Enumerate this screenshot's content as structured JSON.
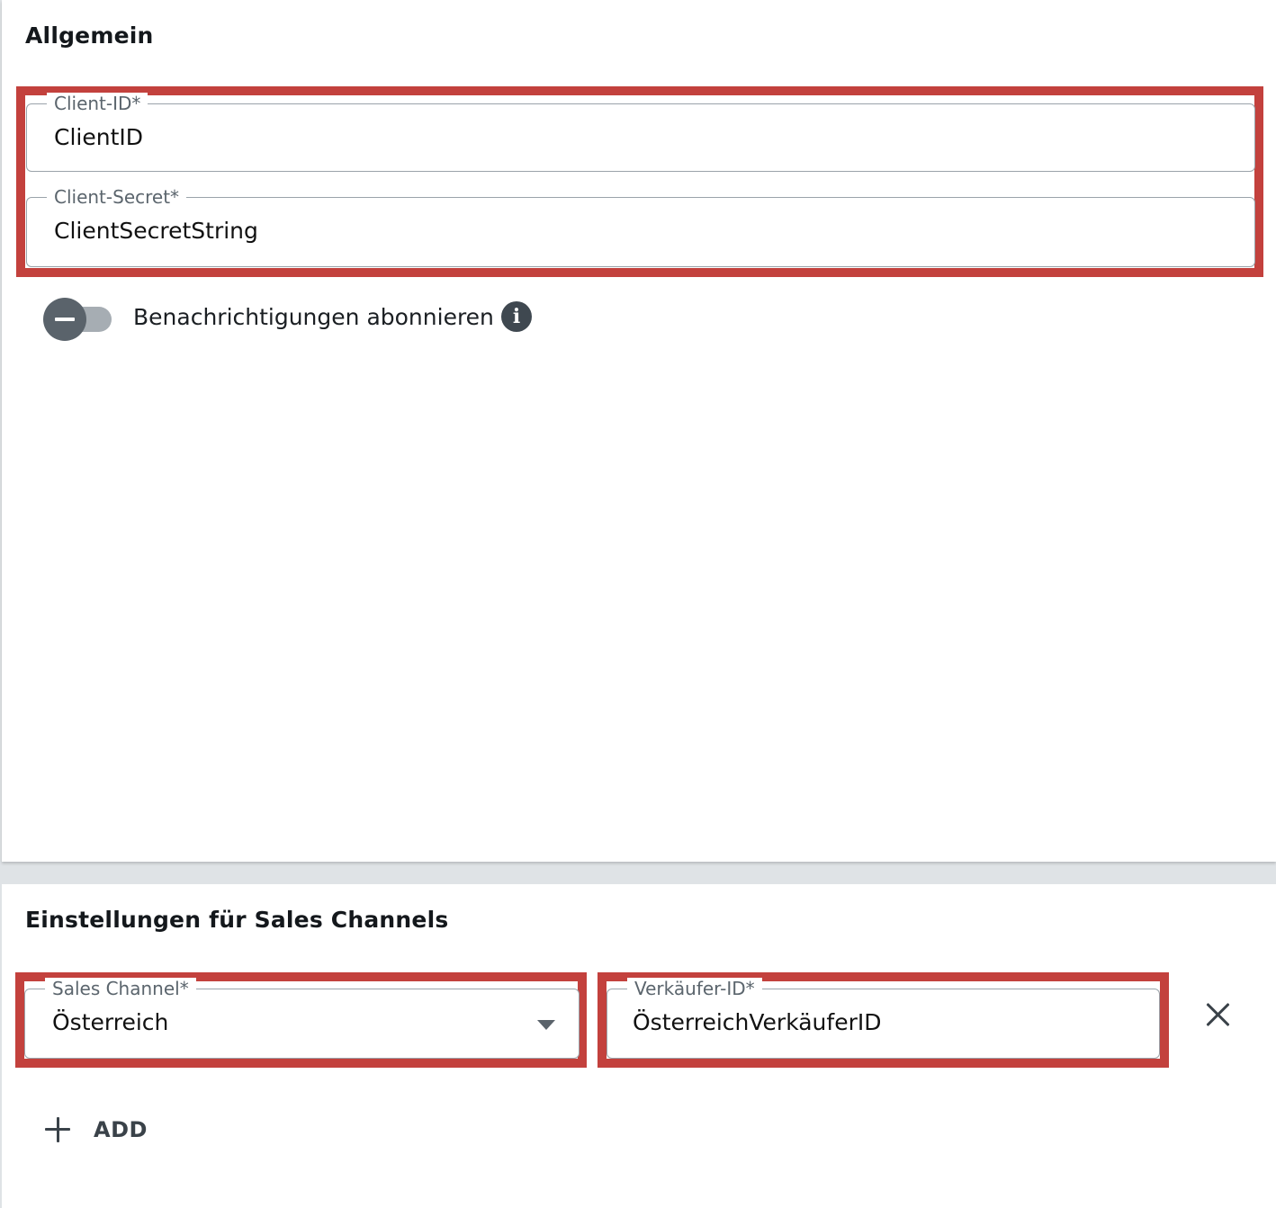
{
  "general": {
    "title": "Allgemein",
    "client_id": {
      "label": "Client-ID*",
      "value": "ClientID"
    },
    "client_secret": {
      "label": "Client-Secret*",
      "value": "ClientSecretString"
    },
    "notifications": {
      "label": "Benachrichtigungen abonnieren",
      "enabled": false,
      "info_icon": "info-icon"
    }
  },
  "channels": {
    "title": "Einstellungen für Sales Channels",
    "sales_channel": {
      "label": "Sales Channel*",
      "value": "Österreich"
    },
    "seller_id": {
      "label": "Verkäufer-ID*",
      "value": "ÖsterreichVerkäuferID"
    },
    "remove_icon": "close-icon",
    "add_label": "ADD",
    "add_icon": "plus-icon"
  },
  "colors": {
    "highlight": "#c3413d",
    "toggle_knob": "#5a636b",
    "toggle_track": "#a6adb3",
    "background": "#dfe3e6"
  }
}
